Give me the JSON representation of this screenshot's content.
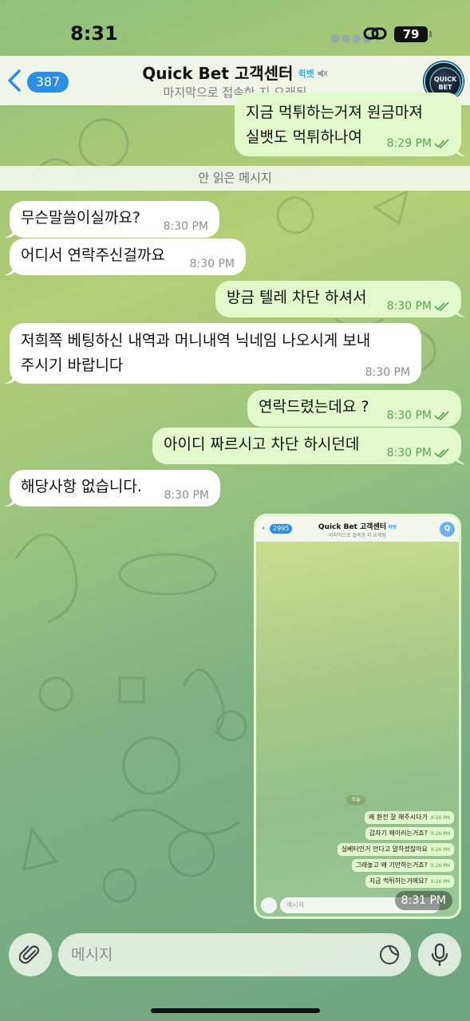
{
  "status_bar": {
    "time": "8:31",
    "battery": "79"
  },
  "header": {
    "back_count": "387",
    "title": "Quick Bet 고객센터",
    "title_tag": "퀵벳",
    "subtitle": "마지막으로 접속한 지 오래됨",
    "avatar_text": "QUICK BET"
  },
  "messages": [
    {
      "dir": "out",
      "text": "지금 먹튀하는거져 원금마져\n실뱃도 먹튀하나여",
      "time": "8:29 PM"
    },
    {
      "dir": "in",
      "text": "무슨말씀이실까요?",
      "time": "8:30 PM"
    },
    {
      "dir": "in",
      "text": "어디서 연락주신걸까요",
      "time": "8:30 PM"
    },
    {
      "dir": "out",
      "text": "방금 텔레 차단 하셔서",
      "time": "8:30 PM"
    },
    {
      "dir": "in",
      "text": "저희쪽 베팅하신 내역과 머니내역 닉네임 나오시게 보내\n주시기 바랍니다",
      "time": "8:30 PM"
    },
    {
      "dir": "out",
      "text": "연락드렸는데요 ?",
      "time": "8:30 PM"
    },
    {
      "dir": "out",
      "text": "아이디 짜르시고 차단 하시던데",
      "time": "8:30 PM"
    },
    {
      "dir": "in",
      "text": "해당사항 없습니다.",
      "time": "8:30 PM"
    }
  ],
  "unread_divider": "안 읽은 메시지",
  "photo": {
    "time": "8:31 PM",
    "mini_header": {
      "back_count": "2995",
      "title": "Quick Bet 고객센터",
      "title_tag": "퀵벳",
      "subtitle": "마지막으로 접속한 지 오래됨",
      "avatar_letter": "Q"
    },
    "date_label": "오늘",
    "mini_messages": [
      {
        "text": "왜 환전 잘 해주시다가",
        "time": "8:26 PM"
      },
      {
        "text": "갑자기 왜이러는거죠?",
        "time": "8:26 PM"
      },
      {
        "text": "실베터인거 안다고 말하셨잖아요",
        "time": "8:26 PM"
      },
      {
        "text": "그래놓고 왜 기만하는거죠?",
        "time": "8:26 PM"
      },
      {
        "text": "지금 먹튀하는거에요?",
        "time": "8:26 PM"
      }
    ],
    "mini_input_placeholder": "메시지"
  },
  "input": {
    "placeholder": "메시지"
  },
  "colors": {
    "incoming": "#ffffff",
    "outgoing": "#e1f9cb",
    "accent": "#2a8ee8",
    "time_out": "#55a64d"
  }
}
